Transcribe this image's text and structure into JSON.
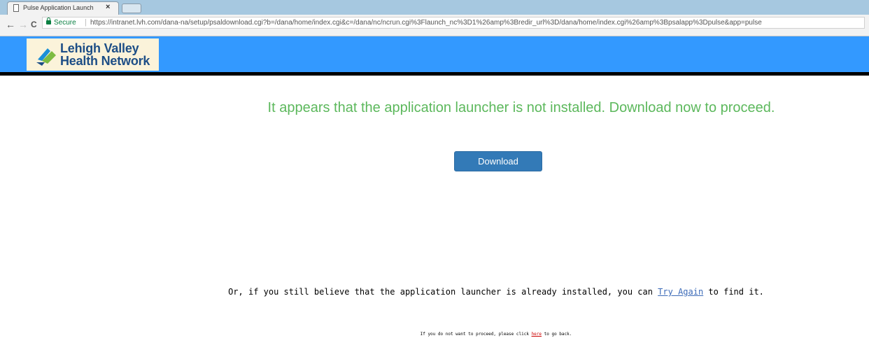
{
  "browser": {
    "tab_title": "Pulse Application Launch",
    "tab_close": "×",
    "back_icon": "←",
    "forward_icon": "→",
    "reload_icon": "C",
    "secure_label": "Secure",
    "separator": "|",
    "url": "https://intranet.lvh.com/dana-na/setup/psaldownload.cgi?b=/dana/home/index.cgi&c=/dana/nc/ncrun.cgi%3Flaunch_nc%3D1%26amp%3Bredir_url%3D/dana/home/index.cgi%26amp%3Bpsalapp%3Dpulse&app=pulse"
  },
  "header": {
    "logo_line1": "Lehigh Valley",
    "logo_line2": "Health Network",
    "bar_color": "#3399ff"
  },
  "main": {
    "headline": "It appears that the application launcher is not installed. Download now to proceed.",
    "download_label": "Download",
    "retry_prefix": "Or, if you still believe that the application launcher is already installed, you can ",
    "retry_link": "Try Again",
    "retry_suffix": " to find it.",
    "goback_prefix": "If you do not want to proceed, please click ",
    "goback_link": "here",
    "goback_suffix": " to go back."
  }
}
